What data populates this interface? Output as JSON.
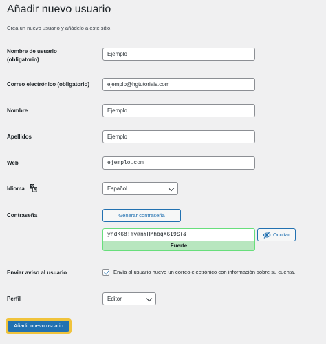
{
  "page": {
    "title": "Añadir nuevo usuario",
    "intro": "Crea un nuevo usuario y añádelo a este sitio."
  },
  "form": {
    "username": {
      "label_line1": "Nombre de usuario",
      "label_line2": "(obligatorio)",
      "value": "Ejemplo"
    },
    "email": {
      "label": "Correo electrónico (obligatorio)",
      "value": "ejemplo@hgtutoriais.com"
    },
    "first_name": {
      "label": "Nombre",
      "value": "Ejemplo"
    },
    "last_name": {
      "label": "Apellidos",
      "value": "Ejemplo"
    },
    "website": {
      "label": "Web",
      "value": "ejemplo.com"
    },
    "language": {
      "label": "Idioma",
      "icon": "translation-icon",
      "selected": "Español"
    },
    "password": {
      "label": "Contraseña",
      "generate_label": "Generar contraseña",
      "value": "yhdK68!mv@nYHMhbqX6I9S(&",
      "strength": "Fuerte",
      "strength_color": "#b8e6bf",
      "hide_label": "Ocultar",
      "hide_icon": "eye-slash-icon"
    },
    "notify": {
      "label": "Enviar aviso al usuario",
      "checked": true,
      "text": "Envía al usuario nuevo un correo electrónico con información sobre su cuenta."
    },
    "role": {
      "label": "Perfil",
      "selected": "Editor"
    },
    "submit_label": "Añadir nuevo usuario"
  },
  "colors": {
    "accent": "#2271b1",
    "background": "#f0f0f1",
    "focus_ring": "#f0c33c",
    "strong_border": "#68de7c"
  }
}
